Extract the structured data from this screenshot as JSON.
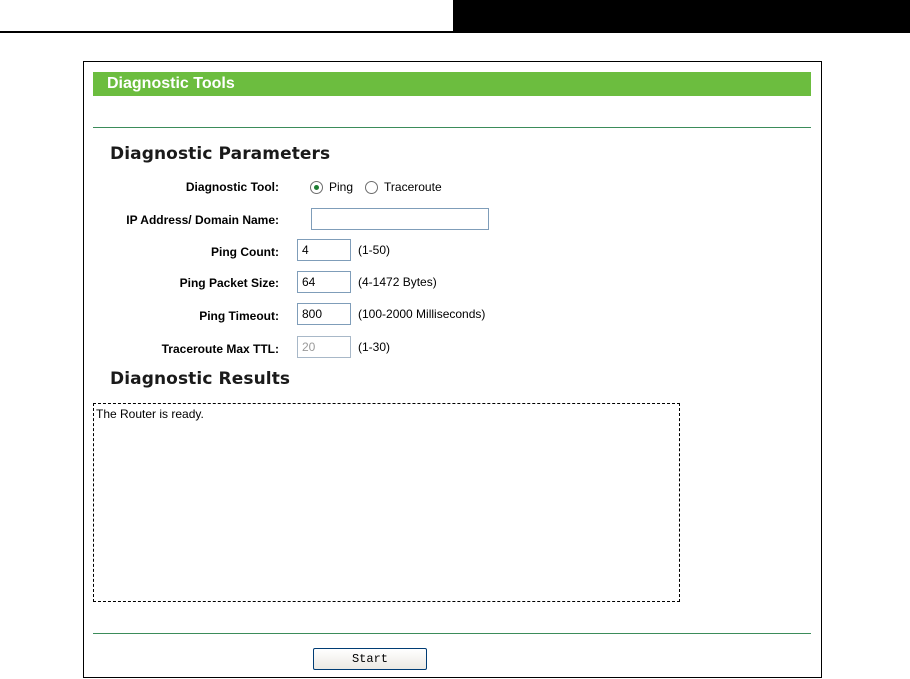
{
  "panel": {
    "title": "Diagnostic Tools"
  },
  "parameters": {
    "section_title": "Diagnostic Parameters",
    "diagnostic_tool": {
      "label": "Diagnostic Tool:",
      "options": [
        "Ping",
        "Traceroute"
      ],
      "selected": "Ping"
    },
    "ip_address": {
      "label": "IP Address/ Domain Name:",
      "value": ""
    },
    "ping_count": {
      "label": "Ping Count:",
      "value": "4",
      "hint": "(1-50)"
    },
    "ping_packet_size": {
      "label": "Ping Packet Size:",
      "value": "64",
      "hint": "(4-1472 Bytes)"
    },
    "ping_timeout": {
      "label": "Ping Timeout:",
      "value": "800",
      "hint": "(100-2000 Milliseconds)"
    },
    "traceroute_max_ttl": {
      "label": "Traceroute Max TTL:",
      "value": "20",
      "hint": "(1-30)",
      "disabled": true
    }
  },
  "results": {
    "section_title": "Diagnostic Results",
    "text": "The Router is ready."
  },
  "actions": {
    "start_label": "Start"
  },
  "colors": {
    "title_bar": "#6cbd3f",
    "rule": "#3b8c5a",
    "radio_dot": "#1e7d33"
  }
}
